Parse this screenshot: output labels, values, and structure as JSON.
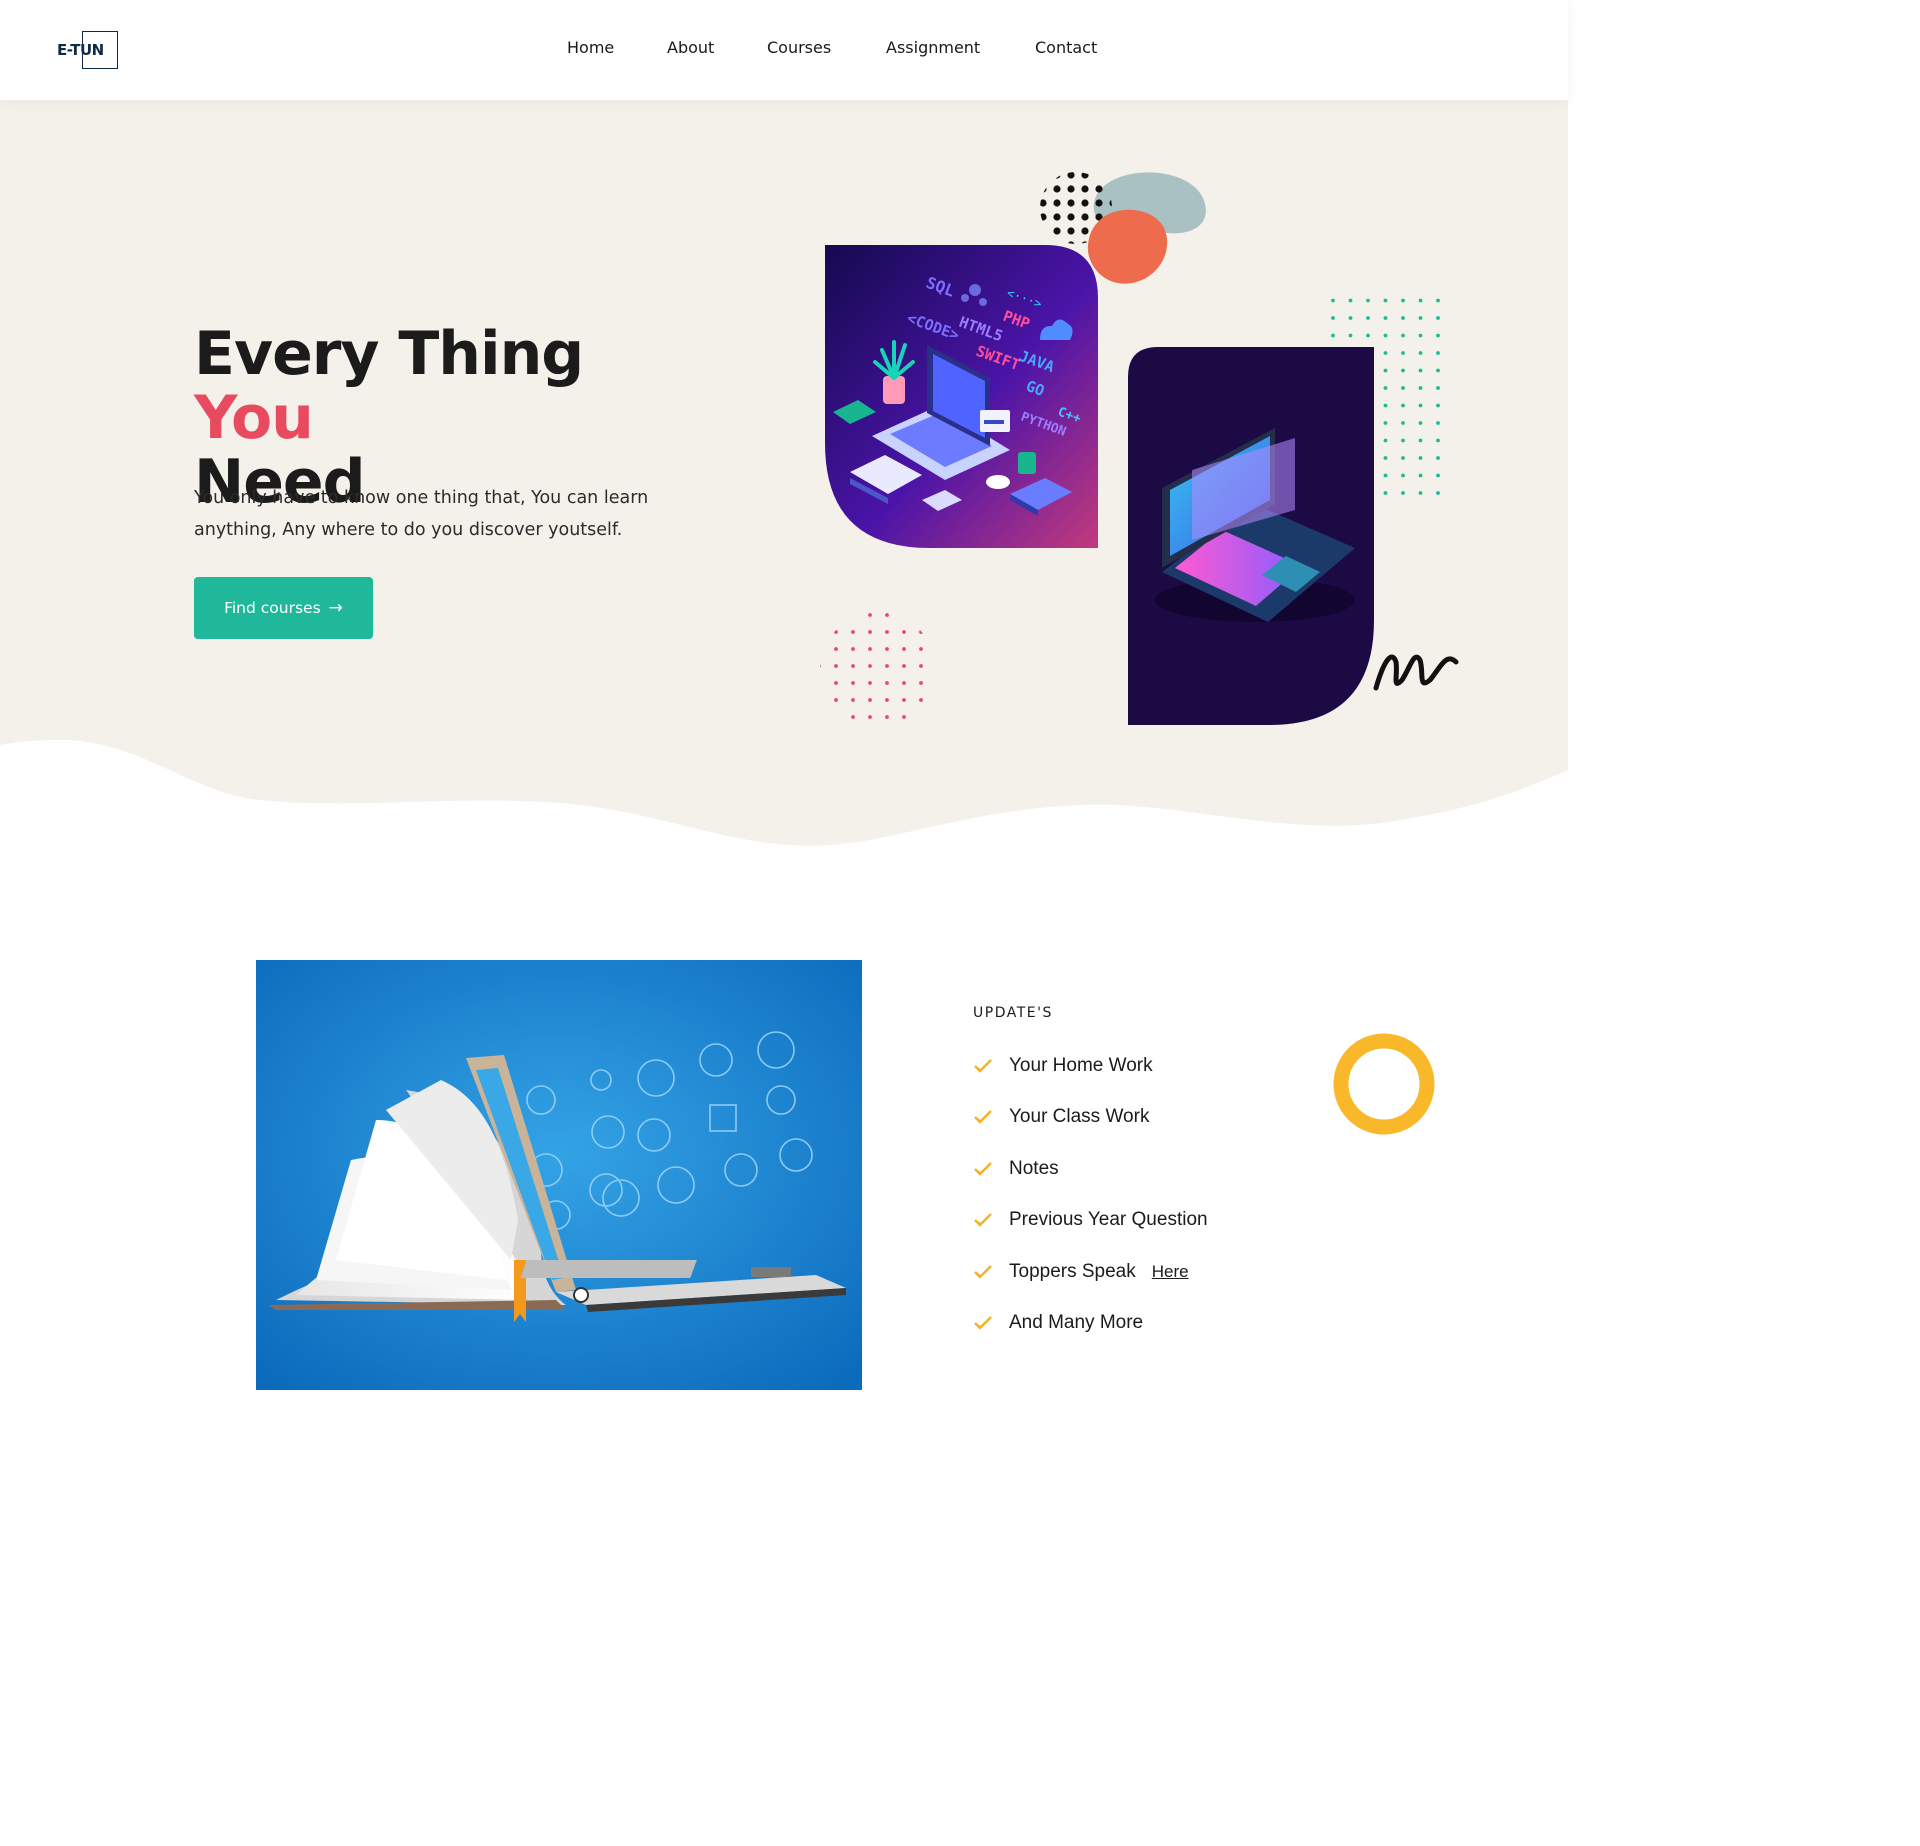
{
  "header": {
    "logo_text": "E-TUN",
    "nav": [
      {
        "label": "Home"
      },
      {
        "label": "About"
      },
      {
        "label": "Courses"
      },
      {
        "label": "Assignment"
      },
      {
        "label": "Contact"
      }
    ]
  },
  "hero": {
    "title_part1": "Every Thing ",
    "title_accent": "You",
    "title_part2": "Need",
    "description": "You only have to know one thing that, You can learn anything, Any where to do you discover youtself.",
    "button_label": "Find courses",
    "code_tags": [
      "SQL",
      "PHP",
      "HTML5",
      "<CODE>",
      "SWIFT",
      "JAVA",
      "GO",
      "C++",
      "PYTHON"
    ]
  },
  "updates": {
    "heading": "UPDATE'S",
    "items": [
      {
        "label": "Your Home Work"
      },
      {
        "label": "Your Class Work"
      },
      {
        "label": "Notes"
      },
      {
        "label": "Previous Year Question"
      },
      {
        "label": "Toppers Speak",
        "link": "Here"
      },
      {
        "label": "And Many More"
      }
    ]
  },
  "colors": {
    "accent_pink": "#e84a5f",
    "button_teal": "#1fb89a",
    "hero_bg": "#f4f1eb",
    "check_yellow": "#f5b223",
    "ring_yellow": "#f9b82a",
    "dark_purple": "#1c0a45"
  }
}
